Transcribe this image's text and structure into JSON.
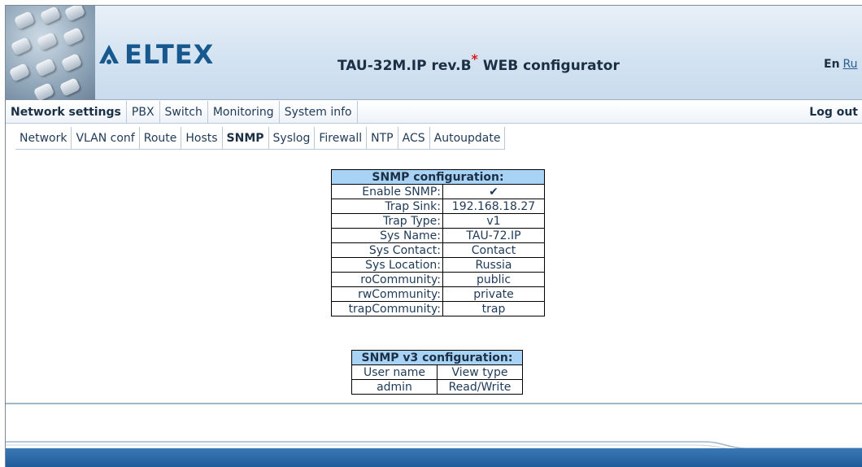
{
  "header": {
    "brand": "ELTEX",
    "title": "TAU-32M.IP rev.B",
    "title_mark": "*",
    "title_suffix": "WEB configurator",
    "lang_en": "En",
    "lang_ru": "Ru"
  },
  "topmenu": {
    "items": [
      "Network settings",
      "PBX",
      "Switch",
      "Monitoring",
      "System info"
    ],
    "active": "Network settings",
    "logout": "Log out"
  },
  "submenu": {
    "items": [
      "Network",
      "VLAN conf",
      "Route",
      "Hosts",
      "SNMP",
      "Syslog",
      "Firewall",
      "NTP",
      "ACS",
      "Autoupdate"
    ],
    "active": "SNMP"
  },
  "snmp": {
    "title": "SNMP configuration:",
    "rows": [
      {
        "label": "Enable SNMP:",
        "value": "✔"
      },
      {
        "label": "Trap Sink:",
        "value": "192.168.18.27"
      },
      {
        "label": "Trap Type:",
        "value": "v1"
      },
      {
        "label": "Sys Name:",
        "value": "TAU-72.IP"
      },
      {
        "label": "Sys Contact:",
        "value": "Contact"
      },
      {
        "label": "Sys Location:",
        "value": "Russia"
      },
      {
        "label": "roCommunity:",
        "value": "public"
      },
      {
        "label": "rwCommunity:",
        "value": "private"
      },
      {
        "label": "trapCommunity:",
        "value": "trap"
      }
    ]
  },
  "snmp_v3": {
    "title": "SNMP v3 configuration:",
    "columns": [
      "User name",
      "View type"
    ],
    "rows": [
      [
        "admin",
        "Read/Write"
      ]
    ]
  },
  "colors": {
    "brand_blue": "#17598f",
    "table_header": "#a9d3f5",
    "footer_bar": "#1f5b98"
  }
}
